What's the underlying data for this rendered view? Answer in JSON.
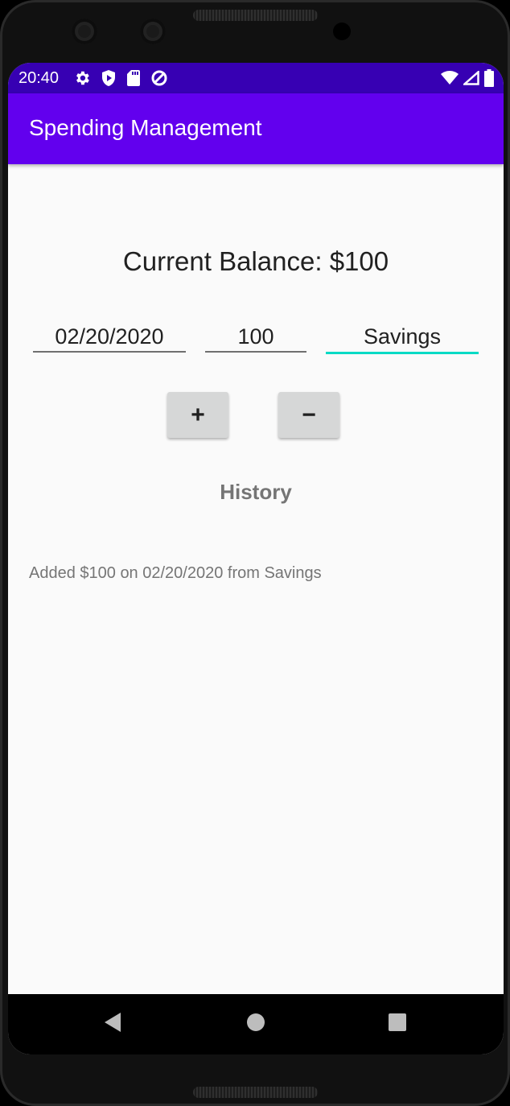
{
  "status_bar": {
    "time": "20:40",
    "left_icons": [
      "gear-icon",
      "shield-icon",
      "sd-card-icon",
      "data-saver-icon"
    ],
    "right_icons": [
      "wifi-icon",
      "cell-signal-icon",
      "battery-icon"
    ]
  },
  "app_bar": {
    "title": "Spending Management",
    "color": "#6200ee",
    "status_color": "#3700b3"
  },
  "balance": {
    "text": "Current Balance: $100"
  },
  "form": {
    "date_value": "02/20/2020",
    "amount_value": "100",
    "source_value": "Savings",
    "focus_color": "#03dac5"
  },
  "buttons": {
    "add_label": "+",
    "subtract_label": "−"
  },
  "history": {
    "title": "History",
    "items": [
      "Added $100 on 02/20/2020 from Savings"
    ]
  },
  "nav_bar": {
    "icons": [
      "back-icon",
      "home-icon",
      "recents-icon"
    ]
  }
}
